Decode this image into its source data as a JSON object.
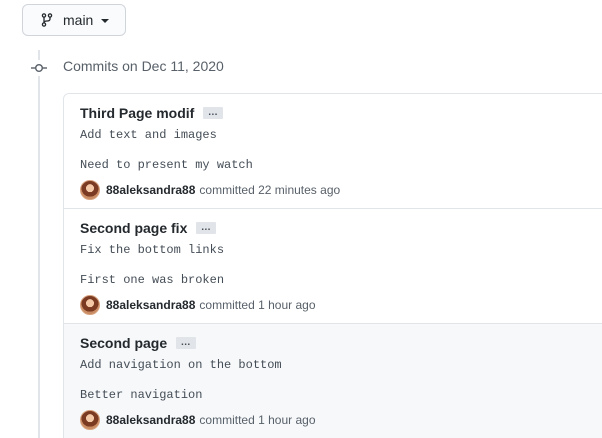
{
  "branch": {
    "name": "main",
    "icon": "git-branch-icon"
  },
  "timeline": {
    "icon": "git-commit-icon",
    "group_title": "Commits on Dec 11, 2020"
  },
  "commits": [
    {
      "title": "Third Page modif",
      "ellipsis": "…",
      "body_line1": "Add text and images",
      "body_line2": "Need to present my watch",
      "author": "88aleksandra88",
      "action": "committed",
      "time": "22 minutes ago"
    },
    {
      "title": "Second page fix",
      "ellipsis": "…",
      "body_line1": "Fix the bottom links",
      "body_line2": "First one was broken",
      "author": "88aleksandra88",
      "action": "committed",
      "time": "1 hour ago"
    },
    {
      "title": "Second page",
      "ellipsis": "…",
      "body_line1": "Add navigation on the bottom",
      "body_line2": "Better navigation",
      "author": "88aleksandra88",
      "action": "committed",
      "time": "1 hour ago"
    }
  ]
}
